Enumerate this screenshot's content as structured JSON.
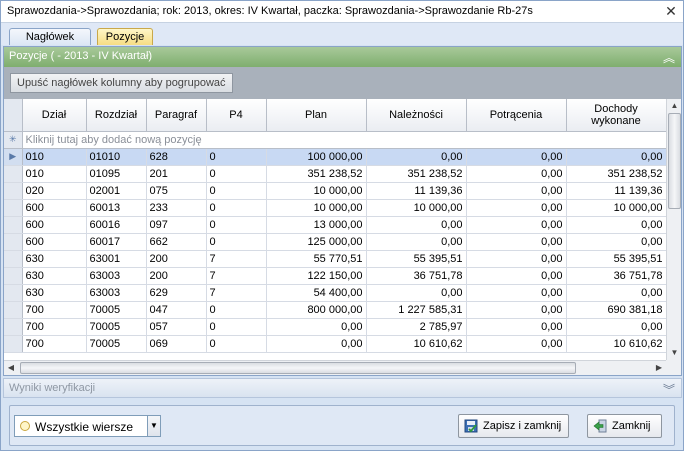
{
  "window": {
    "title": "Sprawozdania->Sprawozdania; rok: 2013, okres: IV Kwartał, paczka: Sprawozdania->Sprawozdanie Rb-27s",
    "close_glyph": "✕"
  },
  "tabs": [
    {
      "label": "Nagłówek",
      "active": false
    },
    {
      "label": "Pozycje",
      "active": true
    }
  ],
  "panel": {
    "title": "Pozycje   ( - 2013 - IV Kwartał)",
    "collapse_glyph": "︽",
    "group_prompt": "Upuść nagłówek kolumny aby pogrupować"
  },
  "grid": {
    "columns": [
      "Dział",
      "Rozdział",
      "Paragraf",
      "P4",
      "Plan",
      "Należności",
      "Potrącenia",
      "Dochody wykonane"
    ],
    "new_row_text": "Kliknij tutaj aby dodać nową pozycję",
    "rows": [
      [
        "010",
        "01010",
        "628",
        "0",
        "100 000,00",
        "0,00",
        "0,00",
        "0,00"
      ],
      [
        "010",
        "01095",
        "201",
        "0",
        "351 238,52",
        "351 238,52",
        "0,00",
        "351 238,52"
      ],
      [
        "020",
        "02001",
        "075",
        "0",
        "10 000,00",
        "11 139,36",
        "0,00",
        "11 139,36"
      ],
      [
        "600",
        "60013",
        "233",
        "0",
        "10 000,00",
        "10 000,00",
        "0,00",
        "10 000,00"
      ],
      [
        "600",
        "60016",
        "097",
        "0",
        "13 000,00",
        "0,00",
        "0,00",
        "0,00"
      ],
      [
        "600",
        "60017",
        "662",
        "0",
        "125 000,00",
        "0,00",
        "0,00",
        "0,00"
      ],
      [
        "630",
        "63001",
        "200",
        "7",
        "55 770,51",
        "55 395,51",
        "0,00",
        "55 395,51"
      ],
      [
        "630",
        "63003",
        "200",
        "7",
        "122 150,00",
        "36 751,78",
        "0,00",
        "36 751,78"
      ],
      [
        "630",
        "63003",
        "629",
        "7",
        "54 400,00",
        "0,00",
        "0,00",
        "0,00"
      ],
      [
        "700",
        "70005",
        "047",
        "0",
        "800 000,00",
        "1 227 585,31",
        "0,00",
        "690 381,18"
      ],
      [
        "700",
        "70005",
        "057",
        "0",
        "0,00",
        "2 785,97",
        "0,00",
        "0,00"
      ],
      [
        "700",
        "70005",
        "069",
        "0",
        "0,00",
        "10 610,62",
        "0,00",
        "10 610,62"
      ]
    ],
    "selected_row": 0
  },
  "verification": {
    "title": "Wyniki weryfikacji",
    "expand_glyph": "︾"
  },
  "footer": {
    "filter_value": "Wszystkie wiersze",
    "save_label": "Zapisz i zamknij",
    "close_label": "Zamknij"
  },
  "colors": {
    "panel_header": "#8fba7f",
    "selected_row": "#c8d9f3",
    "window_bg": "#d6e3f3"
  }
}
